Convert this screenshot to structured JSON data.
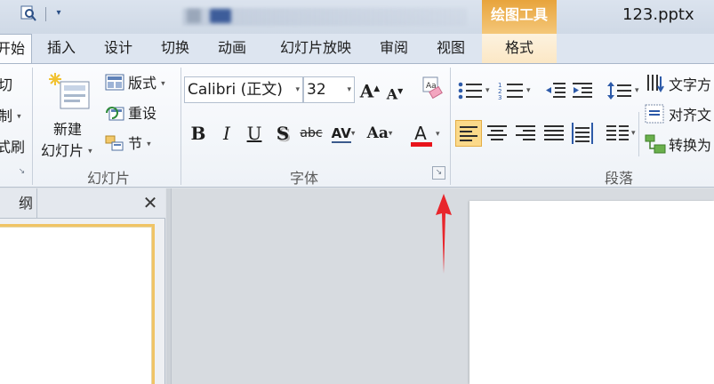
{
  "titlebar": {
    "context_tool_title": "绘图工具",
    "file_name": "123.pptx",
    "qat_icons": [
      "print-preview-icon",
      "customize-qat-icon"
    ]
  },
  "tabs": [
    {
      "label": "开始",
      "name": "tab-home",
      "active": true
    },
    {
      "label": "插入",
      "name": "tab-insert"
    },
    {
      "label": "设计",
      "name": "tab-design"
    },
    {
      "label": "切换",
      "name": "tab-transitions"
    },
    {
      "label": "动画",
      "name": "tab-animations"
    },
    {
      "label": "幻灯片放映",
      "name": "tab-slideshow"
    },
    {
      "label": "审阅",
      "name": "tab-review"
    },
    {
      "label": "视图",
      "name": "tab-view"
    },
    {
      "label": "格式",
      "name": "tab-format"
    }
  ],
  "clipboard": {
    "cut": "切",
    "copy": "制",
    "format_painter": "式刷"
  },
  "slides_group": {
    "label": "幻灯片",
    "new_slide_line1": "新建",
    "new_slide_line2": "幻灯片",
    "layout": "版式",
    "reset": "重设",
    "section": "节"
  },
  "font_group": {
    "label": "字体",
    "font_name": "Calibri (正文)",
    "font_size": "32",
    "grow": "A",
    "shrink": "A",
    "bold": "B",
    "italic": "I",
    "underline": "U",
    "shadow": "S",
    "strike": "abc",
    "spacing": "AV",
    "case": "Aa",
    "color": "A",
    "font_color_hex": "#e8141b"
  },
  "paragraph_group": {
    "label": "段落",
    "text_direction": "文字方",
    "align_text": "对齐文",
    "convert_smartart": "转换为"
  },
  "left_pane": {
    "tab_label": "纲",
    "close": "✕"
  },
  "colors": {
    "accent_context": "#e8a43c",
    "selected_align": "#fbd98a",
    "arrow_red": "#e8262c"
  }
}
